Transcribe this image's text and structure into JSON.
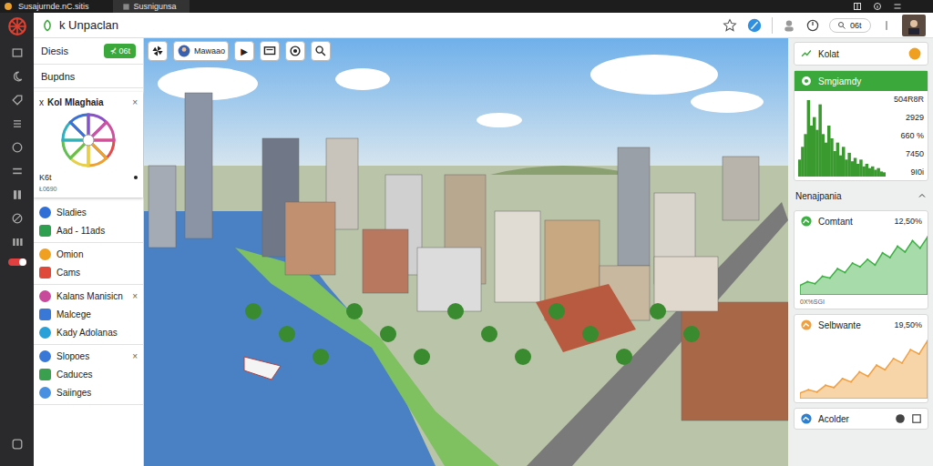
{
  "titlebar": {
    "app": "Susajurnde.nC.sitis",
    "tab": "Susnigunsa"
  },
  "header": {
    "title": "k Unpaclan",
    "search": "06t"
  },
  "rail": {
    "toggle_on": true
  },
  "left_panel": {
    "title": "Diesis",
    "badge": "⊀ 06t",
    "subtitle": "Bupdns",
    "card": {
      "title": "Kol Mlaghaia",
      "close_left": "x",
      "close": "×",
      "label": "K6t",
      "sub": "Ł0690"
    },
    "groups": [
      {
        "close": "",
        "items": [
          {
            "name": "Sladies",
            "color": "#2f6fd6"
          },
          {
            "name": "Aad - 11ads",
            "color": "#2e9e4f"
          }
        ]
      },
      {
        "close": "",
        "items": [
          {
            "name": "Omion",
            "color": "#f0a020"
          },
          {
            "name": "Cams",
            "color": "#e04a3a"
          }
        ]
      },
      {
        "close": "×",
        "items": [
          {
            "name": "Kalans Manisicn",
            "color": "#c84a9a"
          },
          {
            "name": "Malcege",
            "color": "#3a78d8"
          },
          {
            "name": "Kady Adolanas",
            "color": "#2aa0d8"
          }
        ]
      },
      {
        "close": "×",
        "items": [
          {
            "name": "Slopoes",
            "color": "#3a78d8"
          },
          {
            "name": "Caduces",
            "color": "#3aa050"
          },
          {
            "name": "Saiinges",
            "color": "#4a90e0"
          }
        ]
      }
    ]
  },
  "map_toolbar": {
    "user": "Mawaao",
    "play": "▶"
  },
  "right_panel": {
    "top_card": {
      "title": "Kolat"
    },
    "summary": {
      "title": "Smgiamdy",
      "readings": [
        "504R8R",
        "2929",
        "660 %",
        "7450",
        "9I0i"
      ],
      "values": [
        20,
        35,
        50,
        90,
        60,
        70,
        55,
        85,
        50,
        40,
        60,
        45,
        30,
        40,
        25,
        35,
        20,
        28,
        18,
        22,
        15,
        20,
        12,
        15,
        10,
        12,
        8,
        10,
        6,
        5
      ]
    },
    "section": {
      "title": "Nenajpania",
      "expanded": true
    },
    "charts": [
      {
        "title": "Comtant",
        "value": "12,50%",
        "footer": "0X%SGI",
        "color": "#3cb043",
        "values": [
          10,
          14,
          12,
          20,
          18,
          28,
          24,
          34,
          30,
          38,
          32,
          45,
          40,
          52,
          46,
          58,
          50,
          62
        ]
      },
      {
        "title": "Selbwante",
        "value": "19,50%",
        "footer": "",
        "color": "#f0a040",
        "values": [
          5,
          8,
          6,
          12,
          10,
          18,
          15,
          24,
          20,
          30,
          26,
          36,
          32,
          44,
          40,
          52
        ]
      }
    ],
    "bottom": {
      "title": "Acolder"
    }
  }
}
